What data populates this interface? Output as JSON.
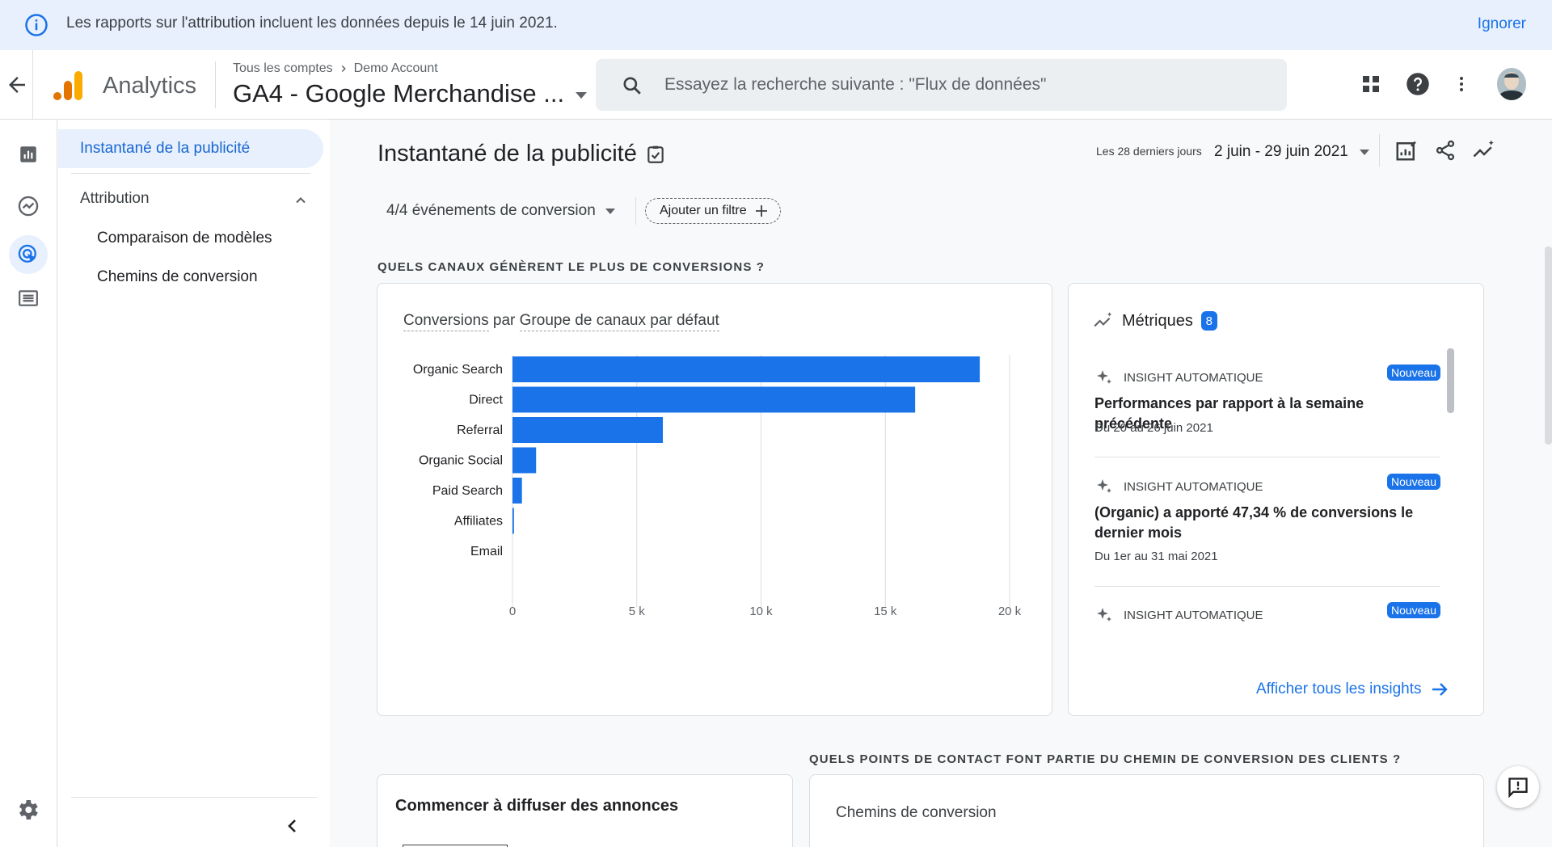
{
  "banner": {
    "message": "Les rapports sur l'attribution incluent les données depuis le 14 juin 2021.",
    "dismiss": "Ignorer"
  },
  "header": {
    "app_name": "Analytics",
    "breadcrumb_all": "Tous les comptes",
    "breadcrumb_account": "Demo Account",
    "property": "GA4 - Google Merchandise ...",
    "search_placeholder": "Essayez la recherche suivante : \"Flux de données\""
  },
  "nav": {
    "active": "Instantané de la publicité",
    "section": "Attribution",
    "items": [
      "Comparaison de modèles",
      "Chemins de conversion"
    ]
  },
  "main": {
    "title": "Instantané de la publicité",
    "date_label": "Les 28 derniers jours",
    "date_range": "2 juin - 29 juin 2021",
    "conversion_selector": "4/4 événements de conversion",
    "add_filter": "Ajouter un filtre",
    "section1": "QUELS CANAUX GÉNÈRENT LE PLUS DE CONVERSIONS ?",
    "section2": "QUELS POINTS DE CONTACT FONT PARTIE DU CHEMIN DE CONVERSION DES CLIENTS ?"
  },
  "chart_card": {
    "metric": "Conversions",
    "by": "par",
    "dimension": "Groupe de canaux par défaut"
  },
  "chart_data": {
    "type": "bar",
    "orientation": "horizontal",
    "categories": [
      "Organic Search",
      "Direct",
      "Referral",
      "Organic Social",
      "Paid Search",
      "Affiliates",
      "Email"
    ],
    "values": [
      18800,
      16200,
      6050,
      950,
      380,
      60,
      0
    ],
    "x_ticks": [
      "0",
      "5 k",
      "10 k",
      "15 k",
      "20 k"
    ],
    "xlim": [
      0,
      20000
    ],
    "grid": true,
    "color": "#1a73e8"
  },
  "insights": {
    "title": "Métriques",
    "count": "8",
    "items": [
      {
        "kind": "INSIGHT AUTOMATIQUE",
        "badge": "Nouveau",
        "title": "Performances par rapport à la semaine précédente",
        "date": "Du 20 au 26 juin 2021"
      },
      {
        "kind": "INSIGHT AUTOMATIQUE",
        "badge": "Nouveau",
        "title": "(Organic) a apporté 47,34 % de conversions le dernier mois",
        "date": "Du 1er au 31 mai 2021"
      },
      {
        "kind": "INSIGHT AUTOMATIQUE",
        "badge": "Nouveau",
        "title": "",
        "date": ""
      }
    ],
    "link": "Afficher tous les insights"
  },
  "bottom": {
    "ads_title": "Commencer à diffuser des annonces",
    "paths_title": "Chemins de conversion"
  },
  "colors": {
    "accent": "#1a73e8",
    "banner_bg": "#e8f0fe",
    "logo_orange": "#f9ab00",
    "logo_dark": "#e37400"
  }
}
